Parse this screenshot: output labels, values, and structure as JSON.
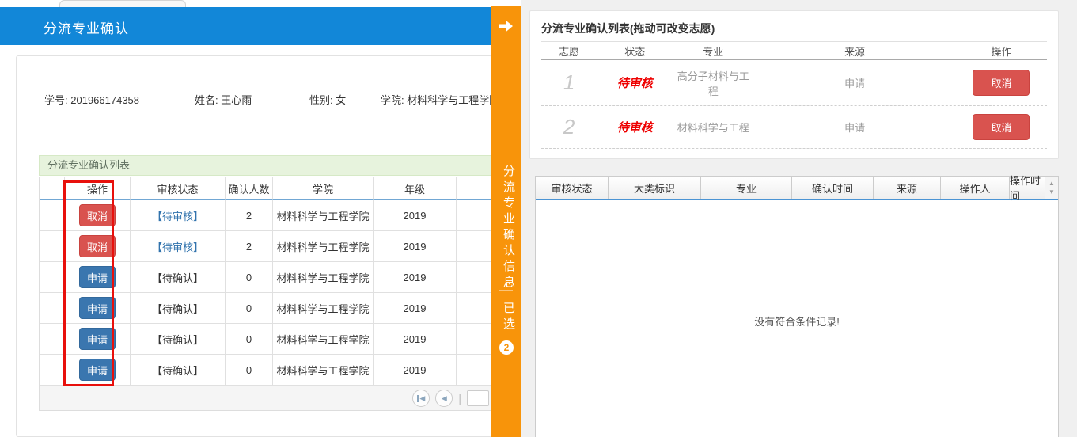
{
  "left": {
    "tab_title": "分流专业确认",
    "student": {
      "fields": [
        {
          "label": "学号:",
          "value": "201966174358"
        },
        {
          "label": "姓名:",
          "value": "王心雨"
        },
        {
          "label": "性别:",
          "value": "女"
        },
        {
          "label": "学院:",
          "value": "材料科学与工程学院"
        }
      ]
    },
    "grid": {
      "caption": "分流专业确认列表",
      "columns": {
        "action": "操作",
        "status": "审核状态",
        "count": "确认人数",
        "college": "学院",
        "grade": "年级"
      },
      "rows": [
        {
          "action": "取消",
          "status": "【待审核】",
          "count": "2",
          "college": "材料科学与工程学院",
          "grade": "2019"
        },
        {
          "action": "取消",
          "status": "【待审核】",
          "count": "2",
          "college": "材料科学与工程学院",
          "grade": "2019"
        },
        {
          "action": "申请",
          "status": "【待确认】",
          "count": "0",
          "college": "材料科学与工程学院",
          "grade": "2019"
        },
        {
          "action": "申请",
          "status": "【待确认】",
          "count": "0",
          "college": "材料科学与工程学院",
          "grade": "2019"
        },
        {
          "action": "申请",
          "status": "【待确认】",
          "count": "0",
          "college": "材料科学与工程学院",
          "grade": "2019"
        },
        {
          "action": "申请",
          "status": "【待确认】",
          "count": "0",
          "college": "材料科学与工程学院",
          "grade": "2019"
        }
      ],
      "pager_separator": "|"
    }
  },
  "side_tab": {
    "title": "分流专业确认信息",
    "selected_label": "已选",
    "badge": "2"
  },
  "right": {
    "volunteers": {
      "title": "分流专业确认列表(拖动可改变志愿)",
      "columns": {
        "rank": "志愿",
        "status": "状态",
        "major": "专业",
        "source": "来源",
        "action": "操作"
      },
      "rows": [
        {
          "rank": "1",
          "status": "待审核",
          "major": "高分子材料与工程",
          "source": "申请",
          "action": "取消"
        },
        {
          "rank": "2",
          "status": "待审核",
          "major": "材料科学与工程",
          "source": "申请",
          "action": "取消"
        }
      ]
    },
    "history": {
      "columns": [
        "审核状态",
        "大类标识",
        "专业",
        "确认时间",
        "来源",
        "操作人",
        "操作时间"
      ],
      "empty_text": "没有符合条件记录!"
    }
  },
  "icons": {
    "sort_up": "▲",
    "sort_down": "▼",
    "page_prev": "◀",
    "page_first": "◀"
  },
  "colors": {
    "header_blue": "#1287d8",
    "side_orange": "#f8940a",
    "danger_red": "#d9534f",
    "primary_blue": "#3a76af",
    "status_link_blue": "#3173ad",
    "status_red": "#ee0000",
    "highlight_red": "#e8100c"
  }
}
